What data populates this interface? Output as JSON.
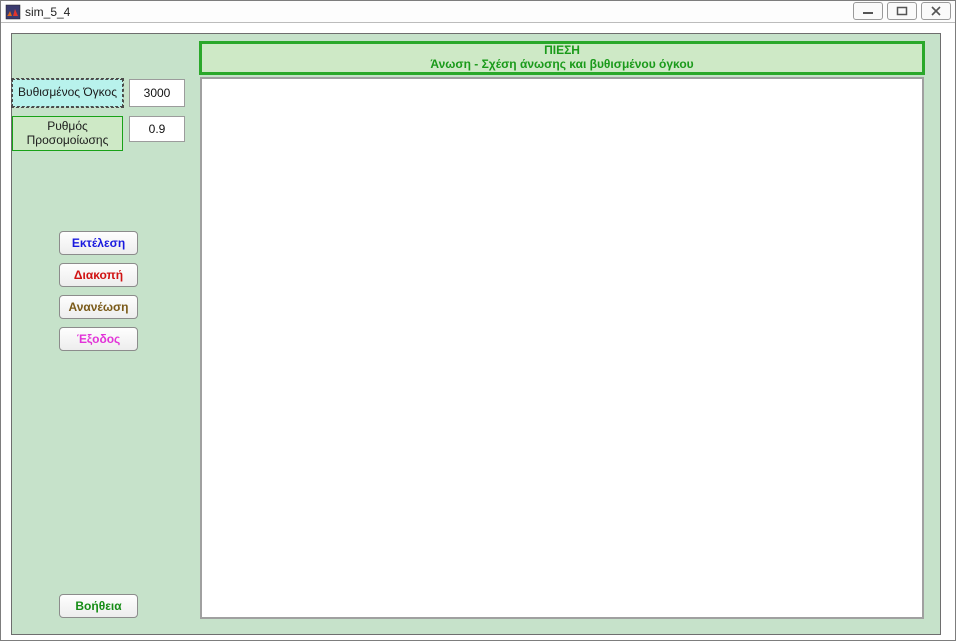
{
  "window": {
    "title": "sim_5_4"
  },
  "header": {
    "line1": "ΠΙΕΣΗ",
    "line2": "Άνωση -  Σχέση άνωσης και βυθισμένου όγκου"
  },
  "params": {
    "volume": {
      "label": "Βυθισμένος Όγκος",
      "value": "3000"
    },
    "rate": {
      "label": "Ρυθμός Προσομοίωσης",
      "value": "0.9"
    }
  },
  "buttons": {
    "run": "Εκτέλεση",
    "stop": "Διακοπή",
    "refresh": "Ανανέωση",
    "exit": "Έξοδος",
    "help": "Βοήθεια"
  }
}
